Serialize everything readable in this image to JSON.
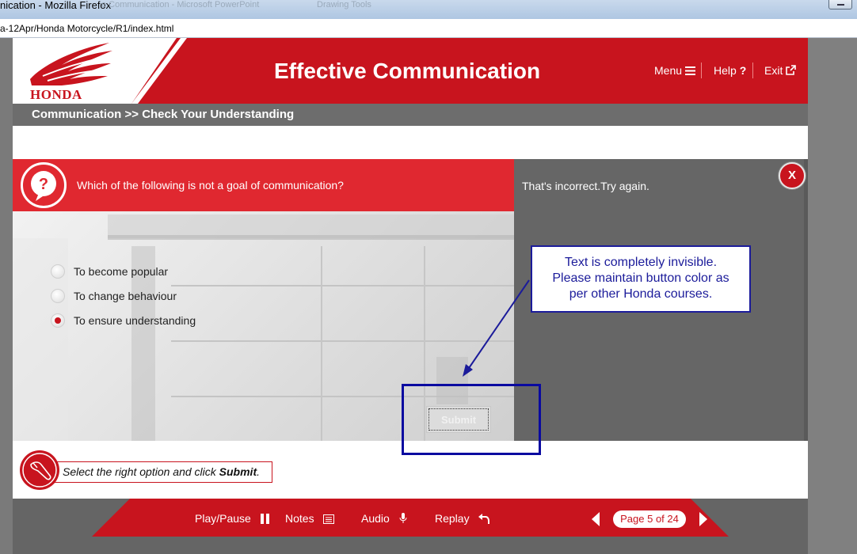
{
  "browser": {
    "window_title": "nication - Mozilla Firefox",
    "background_tabs": [
      "e Communication - Microsoft PowerPoint",
      "Drawing Tools"
    ],
    "url": "a-12Apr/Honda Motorcycle/R1/index.html"
  },
  "header": {
    "logo_text": "HONDA",
    "title": "Effective Communication",
    "menu_label": "Menu",
    "help_label": "Help",
    "exit_label": "Exit"
  },
  "breadcrumb": "Communication >> Check Your Understanding",
  "question": {
    "text": "Which of the following is not a goal of communication?",
    "options": [
      {
        "label": "To become popular",
        "checked": false
      },
      {
        "label": "To change behaviour",
        "checked": false
      },
      {
        "label": "To ensure understanding",
        "checked": true
      }
    ],
    "submit_label": "Submit"
  },
  "feedback": {
    "text": "That's incorrect.Try again.",
    "close_label": "X"
  },
  "annotation": {
    "lines": [
      "Text is completely invisible.",
      "Please maintain button color as",
      "per other Honda courses."
    ]
  },
  "instruction": {
    "prefix": "Select the right option and click ",
    "bold": "Submit",
    "suffix": "."
  },
  "footer": {
    "play_pause": "Play/Pause",
    "notes": "Notes",
    "audio": "Audio",
    "replay": "Replay",
    "page_indicator": "Page 5 of 24"
  },
  "colors": {
    "brand_red": "#c8141e",
    "question_red": "#e02830",
    "annotation_blue": "#1b1b9a",
    "panel_gray": "#666666"
  }
}
